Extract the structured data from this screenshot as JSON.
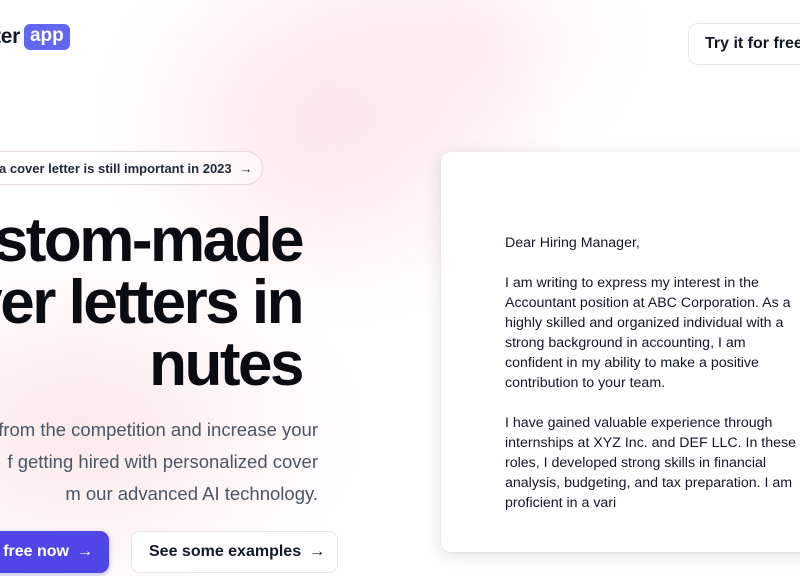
{
  "logo": {
    "text": "ter",
    "badge": "app"
  },
  "header": {
    "cta_label": "Try it for free"
  },
  "announcement": {
    "text": "a cover letter is still important in 2023",
    "arrow": "→"
  },
  "hero": {
    "headline_lines": [
      "stom-made",
      "ver letters in",
      "nutes"
    ],
    "subtext_lines": [
      "from the competition and increase your",
      "f getting hired with personalized cover",
      "m our advanced AI technology."
    ],
    "primary_cta": "free now",
    "secondary_cta": "See some examples",
    "arrow": "→"
  },
  "letter": {
    "greeting": "Dear Hiring Manager,",
    "paragraph1": "I am writing to express my interest in the\nAccountant position at ABC Corporation. As a\nhighly skilled and organized individual with a\nstrong background in accounting, I am\nconfident in my ability to make a positive\ncontribution to your team.",
    "paragraph2": "I have gained valuable experience through\ninternships at XYZ Inc. and DEF LLC. In these\nroles, I developed strong skills in financial\nanalysis, budgeting, and tax preparation. I am\nproficient in a vari"
  },
  "colors": {
    "accent": "#4f46e5",
    "badge": "#6366f1",
    "text": "#111827",
    "muted": "#4b5563"
  }
}
